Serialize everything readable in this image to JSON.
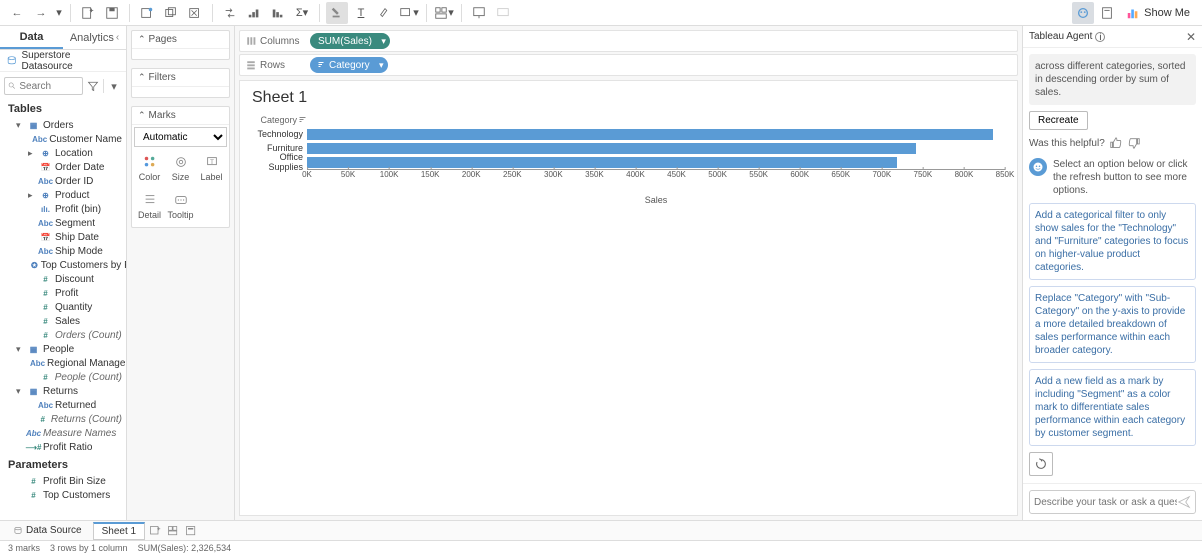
{
  "toolbar": {
    "showMe": "Show Me"
  },
  "sidebar": {
    "tabs": {
      "data": "Data",
      "analytics": "Analytics"
    },
    "datasource": "Superstore Datasource",
    "searchPlaceholder": "Search",
    "tablesHeader": "Tables",
    "sections": [
      {
        "name": "Orders",
        "fields": [
          {
            "icon": "Abc",
            "label": "Customer Name",
            "cls": "dim"
          },
          {
            "icon": "⊕",
            "label": "Location",
            "cls": "dim",
            "expandable": true
          },
          {
            "icon": "📅",
            "label": "Order Date",
            "cls": "dim"
          },
          {
            "icon": "Abc",
            "label": "Order ID",
            "cls": "dim"
          },
          {
            "icon": "⊕",
            "label": "Product",
            "cls": "dim",
            "expandable": true
          },
          {
            "icon": "ılı.",
            "label": "Profit (bin)",
            "cls": "dim"
          },
          {
            "icon": "Abc",
            "label": "Segment",
            "cls": "dim"
          },
          {
            "icon": "📅",
            "label": "Ship Date",
            "cls": "dim"
          },
          {
            "icon": "Abc",
            "label": "Ship Mode",
            "cls": "dim"
          },
          {
            "icon": "✪",
            "label": "Top Customers by P...",
            "cls": "dim"
          },
          {
            "icon": "#",
            "label": "Discount",
            "cls": "meas"
          },
          {
            "icon": "#",
            "label": "Profit",
            "cls": "meas"
          },
          {
            "icon": "#",
            "label": "Quantity",
            "cls": "meas"
          },
          {
            "icon": "#",
            "label": "Sales",
            "cls": "meas"
          },
          {
            "icon": "#",
            "label": "Orders (Count)",
            "cls": "meas",
            "italic": true
          }
        ]
      },
      {
        "name": "People",
        "fields": [
          {
            "icon": "Abc",
            "label": "Regional Manager",
            "cls": "dim"
          },
          {
            "icon": "#",
            "label": "People (Count)",
            "cls": "meas",
            "italic": true
          }
        ]
      },
      {
        "name": "Returns",
        "fields": [
          {
            "icon": "Abc",
            "label": "Returned",
            "cls": "dim"
          },
          {
            "icon": "#",
            "label": "Returns (Count)",
            "cls": "meas",
            "italic": true
          }
        ]
      }
    ],
    "extraFields": [
      {
        "icon": "Abc",
        "label": "Measure Names",
        "cls": "dim",
        "italic": true
      },
      {
        "icon": "⟶#",
        "label": "Profit Ratio",
        "cls": "meas"
      }
    ],
    "paramsHeader": "Parameters",
    "parameters": [
      {
        "icon": "#",
        "label": "Profit Bin Size",
        "cls": "meas"
      },
      {
        "icon": "#",
        "label": "Top Customers",
        "cls": "meas"
      }
    ]
  },
  "shelves": {
    "pages": "Pages",
    "filters": "Filters",
    "marks": "Marks",
    "marksType": "Automatic",
    "marksCells": [
      {
        "l": "Color"
      },
      {
        "l": "Size"
      },
      {
        "l": "Label"
      },
      {
        "l": "Detail"
      },
      {
        "l": "Tooltip"
      }
    ]
  },
  "worksheet": {
    "columnsLabel": "Columns",
    "rowsLabel": "Rows",
    "columnsPill": "SUM(Sales)",
    "rowsPill": "Category",
    "sheetTitle": "Sheet 1",
    "categoryHeader": "Category"
  },
  "chart_data": {
    "type": "bar",
    "orientation": "horizontal",
    "categories": [
      "Technology",
      "Furniture",
      "Office Supplies"
    ],
    "values": [
      836000,
      742000,
      718000
    ],
    "xlabel": "Sales",
    "xlim": [
      0,
      850000
    ],
    "ticks": [
      "0K",
      "50K",
      "100K",
      "150K",
      "200K",
      "250K",
      "300K",
      "350K",
      "400K",
      "450K",
      "500K",
      "550K",
      "600K",
      "650K",
      "700K",
      "750K",
      "800K",
      "850K"
    ]
  },
  "agent": {
    "title": "Tableau Agent",
    "topContext": "across different categories, sorted in descending order by sum of sales.",
    "recreate": "Recreate",
    "helpful": "Was this helpful?",
    "prompt": "Select an option below or click the refresh button to see more options.",
    "suggestions": [
      "Add a categorical filter to only show sales for the \"Technology\" and \"Furniture\" categories to focus on higher-value product categories.",
      "Replace \"Category\" with \"Sub-Category\" on the y-axis to provide a more detailed breakdown of sales performance within each broader category.",
      "Add a new field as a mark by including \"Segment\" as a color mark to differentiate sales performance within each category by customer segment."
    ],
    "inputPlaceholder": "Describe your task or ask a question..."
  },
  "bottom": {
    "dataSource": "Data Source",
    "sheet1": "Sheet 1"
  },
  "status": {
    "marks": "3 marks",
    "rows": "3 rows by 1 column",
    "sum": "SUM(Sales): 2,326,534"
  }
}
